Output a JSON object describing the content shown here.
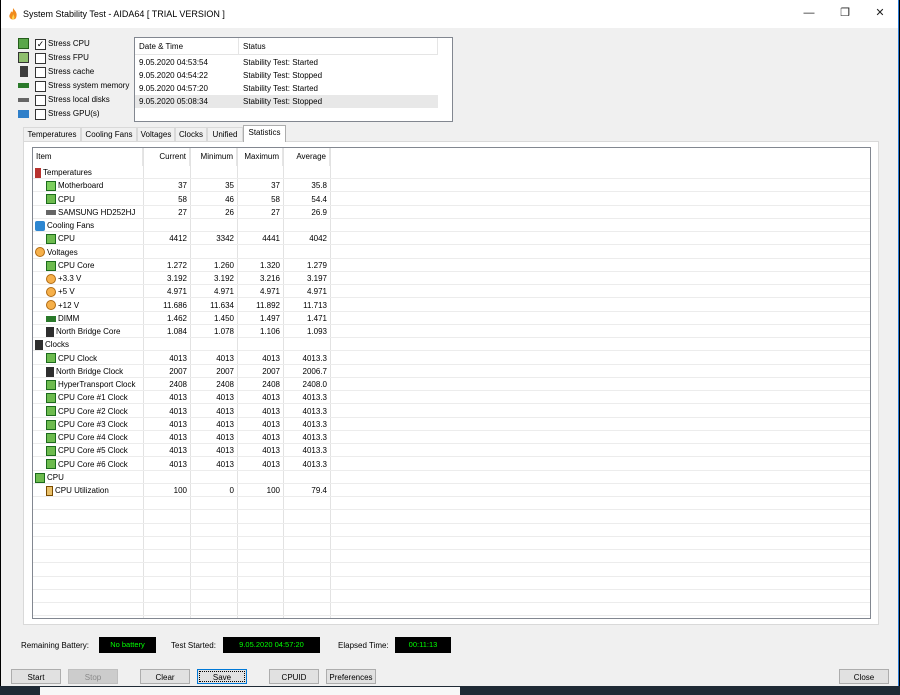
{
  "window": {
    "title": "System Stability Test - AIDA64  [ TRIAL VERSION ]"
  },
  "controls": {
    "minimize": "—",
    "maximize": "❐",
    "close": "✕"
  },
  "stress_options": [
    {
      "label": "Stress CPU",
      "checked": "✓",
      "icon": "cpu-icon"
    },
    {
      "label": "Stress FPU",
      "checked": "",
      "icon": "fpu-icon"
    },
    {
      "label": "Stress cache",
      "checked": "",
      "icon": "cache-icon"
    },
    {
      "label": "Stress system memory",
      "checked": "",
      "icon": "memory-icon"
    },
    {
      "label": "Stress local disks",
      "checked": "",
      "icon": "disk-icon"
    },
    {
      "label": "Stress GPU(s)",
      "checked": "",
      "icon": "gpu-icon"
    }
  ],
  "log": {
    "headers": {
      "date": "Date & Time",
      "status": "Status"
    },
    "rows": [
      {
        "date": "9.05.2020 04:53:54",
        "status": "Stability Test: Started"
      },
      {
        "date": "9.05.2020 04:54:22",
        "status": "Stability Test: Stopped"
      },
      {
        "date": "9.05.2020 04:57:20",
        "status": "Stability Test: Started"
      },
      {
        "date": "9.05.2020 05:08:34",
        "status": "Stability Test: Stopped"
      }
    ]
  },
  "tabs": [
    "Temperatures",
    "Cooling Fans",
    "Voltages",
    "Clocks",
    "Unified",
    "Statistics"
  ],
  "active_tab": "Statistics",
  "stats": {
    "headers": {
      "item": "Item",
      "current": "Current",
      "minimum": "Minimum",
      "maximum": "Maximum",
      "average": "Average"
    },
    "rows": [
      {
        "item": "Temperatures",
        "icon": "temp",
        "group": true,
        "current": "",
        "minimum": "",
        "maximum": "",
        "average": ""
      },
      {
        "item": "Motherboard",
        "icon": "mb",
        "group": false,
        "current": "37",
        "minimum": "35",
        "maximum": "37",
        "average": "35.8"
      },
      {
        "item": "CPU",
        "icon": "chip",
        "group": false,
        "current": "58",
        "minimum": "46",
        "maximum": "58",
        "average": "54.4"
      },
      {
        "item": "SAMSUNG HD252HJ",
        "icon": "disk",
        "group": false,
        "current": "27",
        "minimum": "26",
        "maximum": "27",
        "average": "26.9"
      },
      {
        "item": "Cooling Fans",
        "icon": "fan",
        "group": true,
        "current": "",
        "minimum": "",
        "maximum": "",
        "average": ""
      },
      {
        "item": "CPU",
        "icon": "chip",
        "group": false,
        "current": "4412",
        "minimum": "3342",
        "maximum": "4441",
        "average": "4042"
      },
      {
        "item": "Voltages",
        "icon": "volt",
        "group": true,
        "current": "",
        "minimum": "",
        "maximum": "",
        "average": ""
      },
      {
        "item": "CPU Core",
        "icon": "chip",
        "group": false,
        "current": "1.272",
        "minimum": "1.260",
        "maximum": "1.320",
        "average": "1.279"
      },
      {
        "item": "+3.3 V",
        "icon": "volt",
        "group": false,
        "current": "3.192",
        "minimum": "3.192",
        "maximum": "3.216",
        "average": "3.197"
      },
      {
        "item": "+5 V",
        "icon": "volt",
        "group": false,
        "current": "4.971",
        "minimum": "4.971",
        "maximum": "4.971",
        "average": "4.971"
      },
      {
        "item": "+12 V",
        "icon": "volt",
        "group": false,
        "current": "11.686",
        "minimum": "11.634",
        "maximum": "11.892",
        "average": "11.713"
      },
      {
        "item": "DIMM",
        "icon": "dimm",
        "group": false,
        "current": "1.462",
        "minimum": "1.450",
        "maximum": "1.497",
        "average": "1.471"
      },
      {
        "item": "North Bridge Core",
        "icon": "clock",
        "group": false,
        "current": "1.084",
        "minimum": "1.078",
        "maximum": "1.106",
        "average": "1.093"
      },
      {
        "item": "Clocks",
        "icon": "clock",
        "group": true,
        "current": "",
        "minimum": "",
        "maximum": "",
        "average": ""
      },
      {
        "item": "CPU Clock",
        "icon": "chip",
        "group": false,
        "current": "4013",
        "minimum": "4013",
        "maximum": "4013",
        "average": "4013.3"
      },
      {
        "item": "North Bridge Clock",
        "icon": "clock",
        "group": false,
        "current": "2007",
        "minimum": "2007",
        "maximum": "2007",
        "average": "2006.7"
      },
      {
        "item": "HyperTransport Clock",
        "icon": "chip",
        "group": false,
        "current": "2408",
        "minimum": "2408",
        "maximum": "2408",
        "average": "2408.0"
      },
      {
        "item": "CPU Core #1 Clock",
        "icon": "chip",
        "group": false,
        "current": "4013",
        "minimum": "4013",
        "maximum": "4013",
        "average": "4013.3"
      },
      {
        "item": "CPU Core #2 Clock",
        "icon": "chip",
        "group": false,
        "current": "4013",
        "minimum": "4013",
        "maximum": "4013",
        "average": "4013.3"
      },
      {
        "item": "CPU Core #3 Clock",
        "icon": "chip",
        "group": false,
        "current": "4013",
        "minimum": "4013",
        "maximum": "4013",
        "average": "4013.3"
      },
      {
        "item": "CPU Core #4 Clock",
        "icon": "chip",
        "group": false,
        "current": "4013",
        "minimum": "4013",
        "maximum": "4013",
        "average": "4013.3"
      },
      {
        "item": "CPU Core #5 Clock",
        "icon": "chip",
        "group": false,
        "current": "4013",
        "minimum": "4013",
        "maximum": "4013",
        "average": "4013.3"
      },
      {
        "item": "CPU Core #6 Clock",
        "icon": "chip",
        "group": false,
        "current": "4013",
        "minimum": "4013",
        "maximum": "4013",
        "average": "4013.3"
      },
      {
        "item": "CPU",
        "icon": "chip",
        "group": true,
        "current": "",
        "minimum": "",
        "maximum": "",
        "average": ""
      },
      {
        "item": "CPU Utilization",
        "icon": "hour",
        "group": false,
        "current": "100",
        "minimum": "0",
        "maximum": "100",
        "average": "79.4"
      }
    ]
  },
  "status_bar": {
    "battery_label": "Remaining Battery:",
    "battery_value": "No battery",
    "started_label": "Test Started:",
    "started_value": "9.05.2020 04:57:20",
    "elapsed_label": "Elapsed Time:",
    "elapsed_value": "00:11:13"
  },
  "buttons": {
    "start": "Start",
    "stop": "Stop",
    "clear": "Clear",
    "save": "Save",
    "cpuid": "CPUID",
    "preferences": "Preferences",
    "close": "Close"
  }
}
